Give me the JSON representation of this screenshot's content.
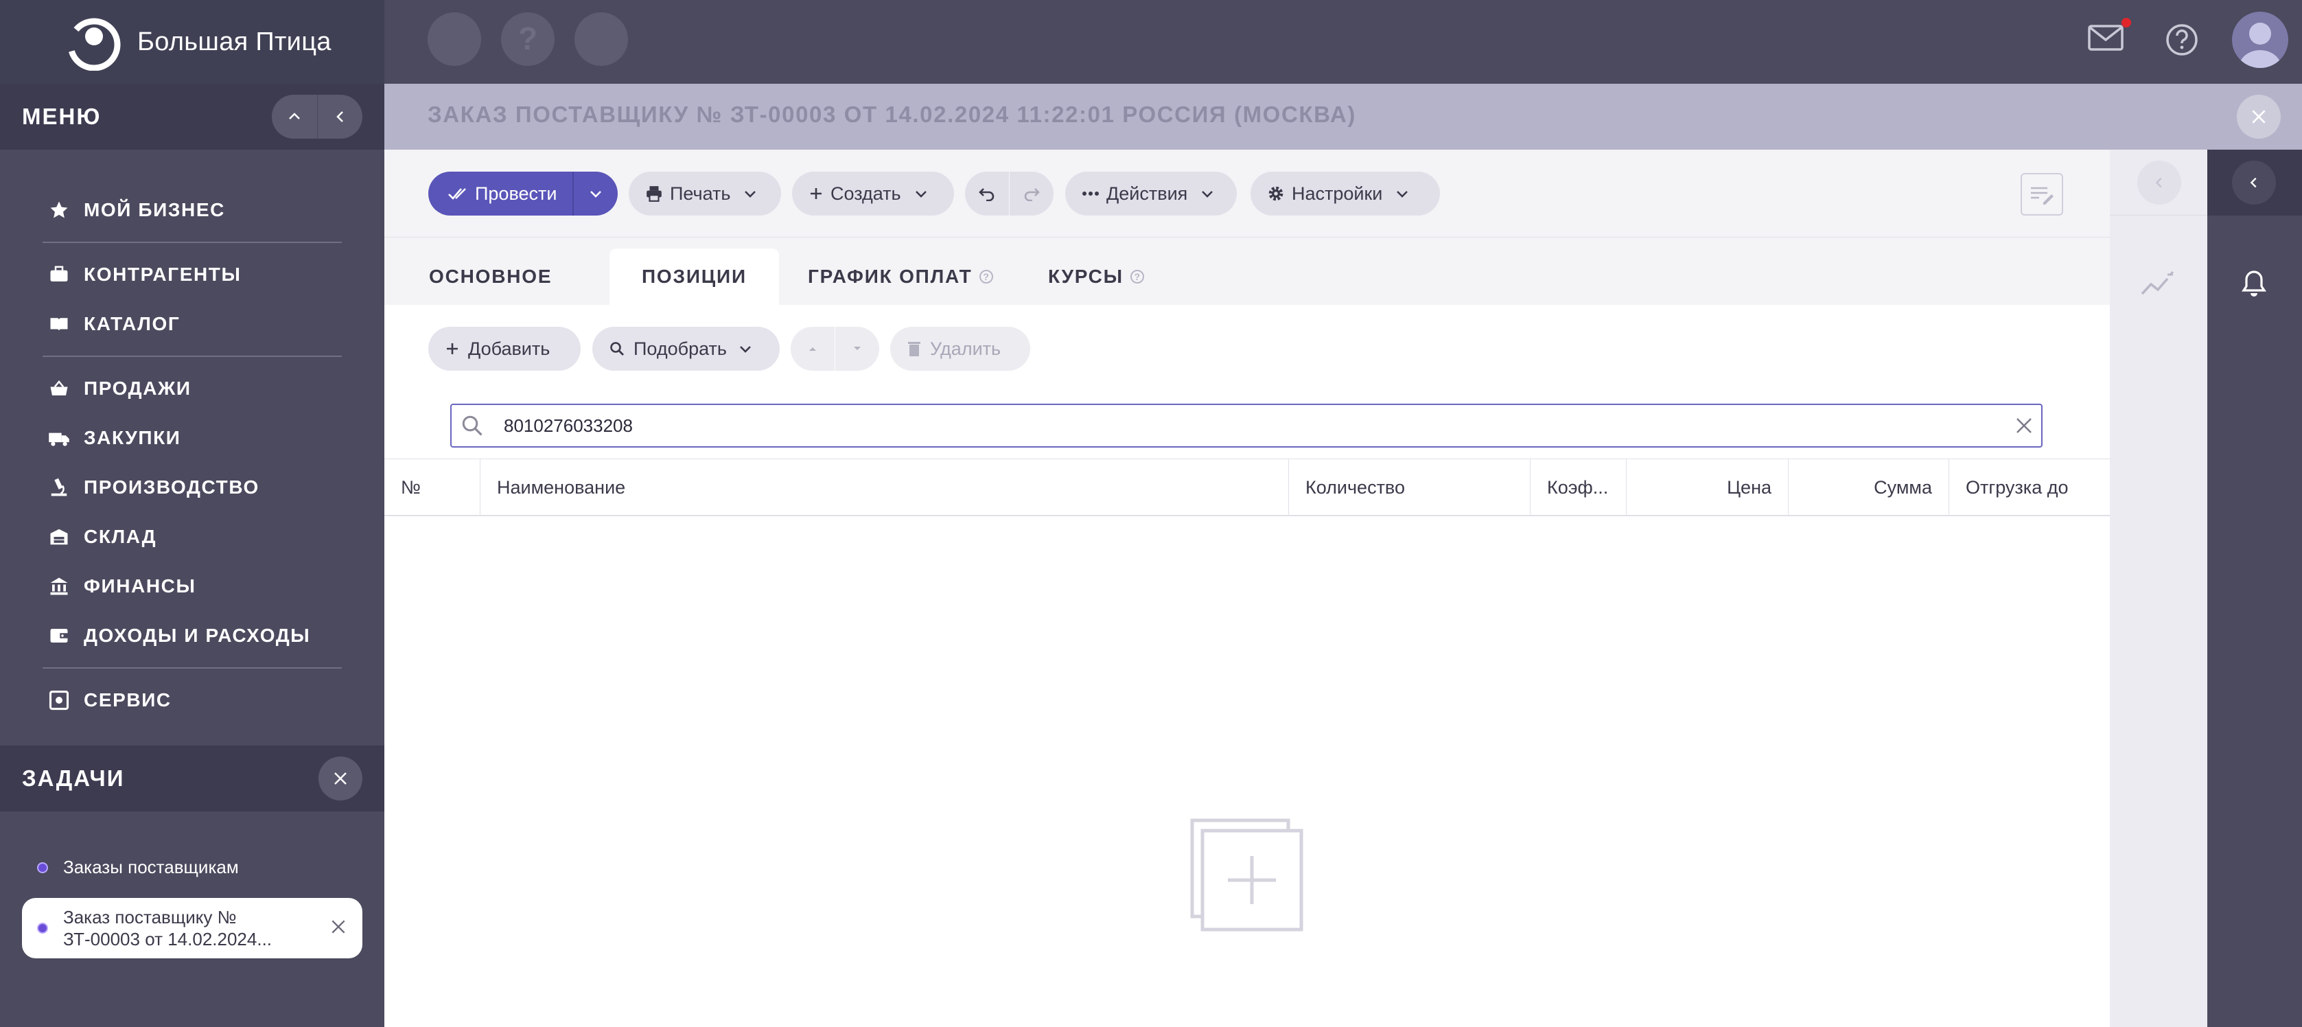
{
  "app": {
    "brand_name": "Большая Птица"
  },
  "sidebar": {
    "menu_title": "МЕНЮ",
    "items": [
      {
        "label": "МОЙ БИЗНЕС",
        "icon": "star-icon"
      },
      {
        "label": "КОНТРАГЕНТЫ",
        "icon": "briefcase-icon"
      },
      {
        "label": "КАТАЛОГ",
        "icon": "book-icon"
      },
      {
        "label": "ПРОДАЖИ",
        "icon": "basket-icon"
      },
      {
        "label": "ЗАКУПКИ",
        "icon": "truck-icon"
      },
      {
        "label": "ПРОИЗВОДСТВО",
        "icon": "microscope-icon"
      },
      {
        "label": "СКЛАД",
        "icon": "warehouse-icon"
      },
      {
        "label": "ФИНАНСЫ",
        "icon": "bank-icon"
      },
      {
        "label": "ДОХОДЫ И РАСХОДЫ",
        "icon": "wallet-icon"
      },
      {
        "label": "СЕРВИС",
        "icon": "service-icon"
      }
    ],
    "tasks_title": "ЗАДАЧИ",
    "tasks": [
      {
        "label": "Заказы поставщикам"
      },
      {
        "label": "Заказ поставщику № ЗТ-00003 от 14.02.2024..."
      }
    ]
  },
  "document": {
    "title": "ЗАКАЗ ПОСТАВЩИКУ № ЗТ-00003 ОТ 14.02.2024 11:22:01 РОССИЯ (МОСКВА)"
  },
  "toolbar": {
    "post_label": "Провести",
    "print_label": "Печать",
    "create_label": "Создать",
    "actions_label": "Действия",
    "settings_label": "Настройки"
  },
  "tabs": [
    {
      "label": "ОСНОВНОЕ",
      "active": false
    },
    {
      "label": "ПОЗИЦИИ",
      "active": true
    },
    {
      "label": "ГРАФИК ОПЛАТ",
      "active": false
    },
    {
      "label": "КУРСЫ",
      "active": false
    }
  ],
  "positions": {
    "add_label": "Добавить",
    "select_label": "Подобрать",
    "delete_label": "Удалить",
    "search_value": "8010276033208",
    "columns": [
      "№",
      "Наименование",
      "Количество",
      "Коэф...",
      "Цена",
      "Сумма",
      "Отгрузка до"
    ]
  },
  "colors": {
    "accent": "#5a55b8",
    "sidebar_bg": "#4b4a5e",
    "title_bar_bg": "#b5b3c9",
    "notification_dot": "#e0262b"
  }
}
